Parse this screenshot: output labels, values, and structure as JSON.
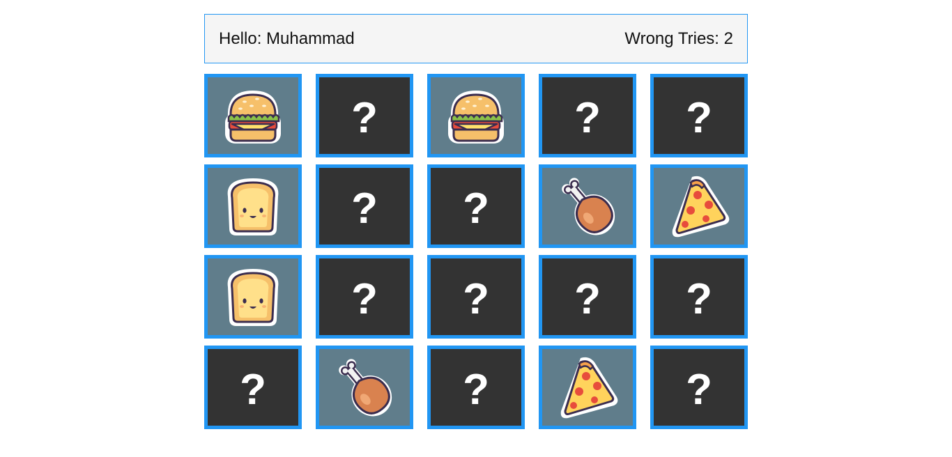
{
  "header": {
    "greeting": "Hello: Muhammad",
    "wrong_tries": "Wrong Tries: 2"
  },
  "colors": {
    "card_border": "#2196f3",
    "card_hidden": "#333333",
    "card_revealed": "#607d8b",
    "info_bar_bg": "#f5f5f5"
  },
  "hidden_symbol": "?",
  "cards": [
    {
      "state": "revealed",
      "icon": "burger-icon"
    },
    {
      "state": "hidden"
    },
    {
      "state": "revealed",
      "icon": "burger-icon"
    },
    {
      "state": "hidden"
    },
    {
      "state": "hidden"
    },
    {
      "state": "revealed",
      "icon": "toast-icon"
    },
    {
      "state": "hidden"
    },
    {
      "state": "hidden"
    },
    {
      "state": "revealed",
      "icon": "chicken-leg-icon"
    },
    {
      "state": "revealed",
      "icon": "pizza-slice-icon"
    },
    {
      "state": "revealed",
      "icon": "toast-icon"
    },
    {
      "state": "hidden"
    },
    {
      "state": "hidden"
    },
    {
      "state": "hidden"
    },
    {
      "state": "hidden"
    },
    {
      "state": "hidden"
    },
    {
      "state": "revealed",
      "icon": "chicken-leg-icon"
    },
    {
      "state": "hidden"
    },
    {
      "state": "revealed",
      "icon": "pizza-slice-icon"
    },
    {
      "state": "hidden"
    }
  ]
}
